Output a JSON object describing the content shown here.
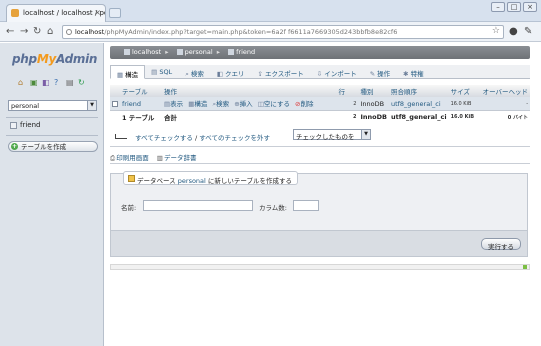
{
  "browser": {
    "tab_title": "localhost / localhost / pers",
    "url_host": "localhost",
    "url_path": "/phpMyAdmin/index.php?target=main.php&token=6a2f f6611a7669305d243bbfb8e82cf6"
  },
  "left": {
    "logo_php": "php",
    "logo_my": "My",
    "logo_admin": "Admin",
    "db_selected": "personal",
    "tables": [
      "friend"
    ],
    "create_table_label": "テーブルを作成"
  },
  "breadcrumb": {
    "server": "localhost",
    "database": "personal",
    "table": "friend"
  },
  "tabs": [
    {
      "label": "構造",
      "active": true
    },
    {
      "label": "SQL"
    },
    {
      "label": "検索"
    },
    {
      "label": "クエリ"
    },
    {
      "label": "エクスポート"
    },
    {
      "label": "インポート"
    },
    {
      "label": "操作"
    },
    {
      "label": "特権"
    }
  ],
  "table": {
    "headers": {
      "table": "テーブル",
      "action": "操作",
      "rows": "行",
      "type": "種別",
      "collation": "照合順序",
      "size": "サイズ",
      "overhead": "オーバーヘッド"
    },
    "actions": [
      "表示",
      "構造",
      "検索",
      "挿入",
      "空にする",
      "削除"
    ],
    "rows": [
      {
        "name": "friend",
        "rows": "2",
        "type": "InnoDB",
        "collation": "utf8_general_ci",
        "size": "16.0 KiB",
        "overhead": "-"
      }
    ],
    "summary": {
      "label": "1 テーブル",
      "total": "合計",
      "rows": "2",
      "type": "InnoDB",
      "collation": "utf8_general_ci",
      "size": "16.0 KiB",
      "overhead": "0 バイト"
    }
  },
  "checkall": {
    "check_all": "すべてチェックする",
    "separator": " / ",
    "uncheck_all": "すべてのチェックを外す",
    "with_selected": "チェックしたものを"
  },
  "print_links": {
    "print": "印刷用画面",
    "dictionary": "データ辞書"
  },
  "create": {
    "legend_prefix": "データベース",
    "legend_db": "personal",
    "legend_suffix": "に新しいテーブルを作成する",
    "name_label": "名前:",
    "columns_label": "カラム数:",
    "go_label": "実行する"
  }
}
